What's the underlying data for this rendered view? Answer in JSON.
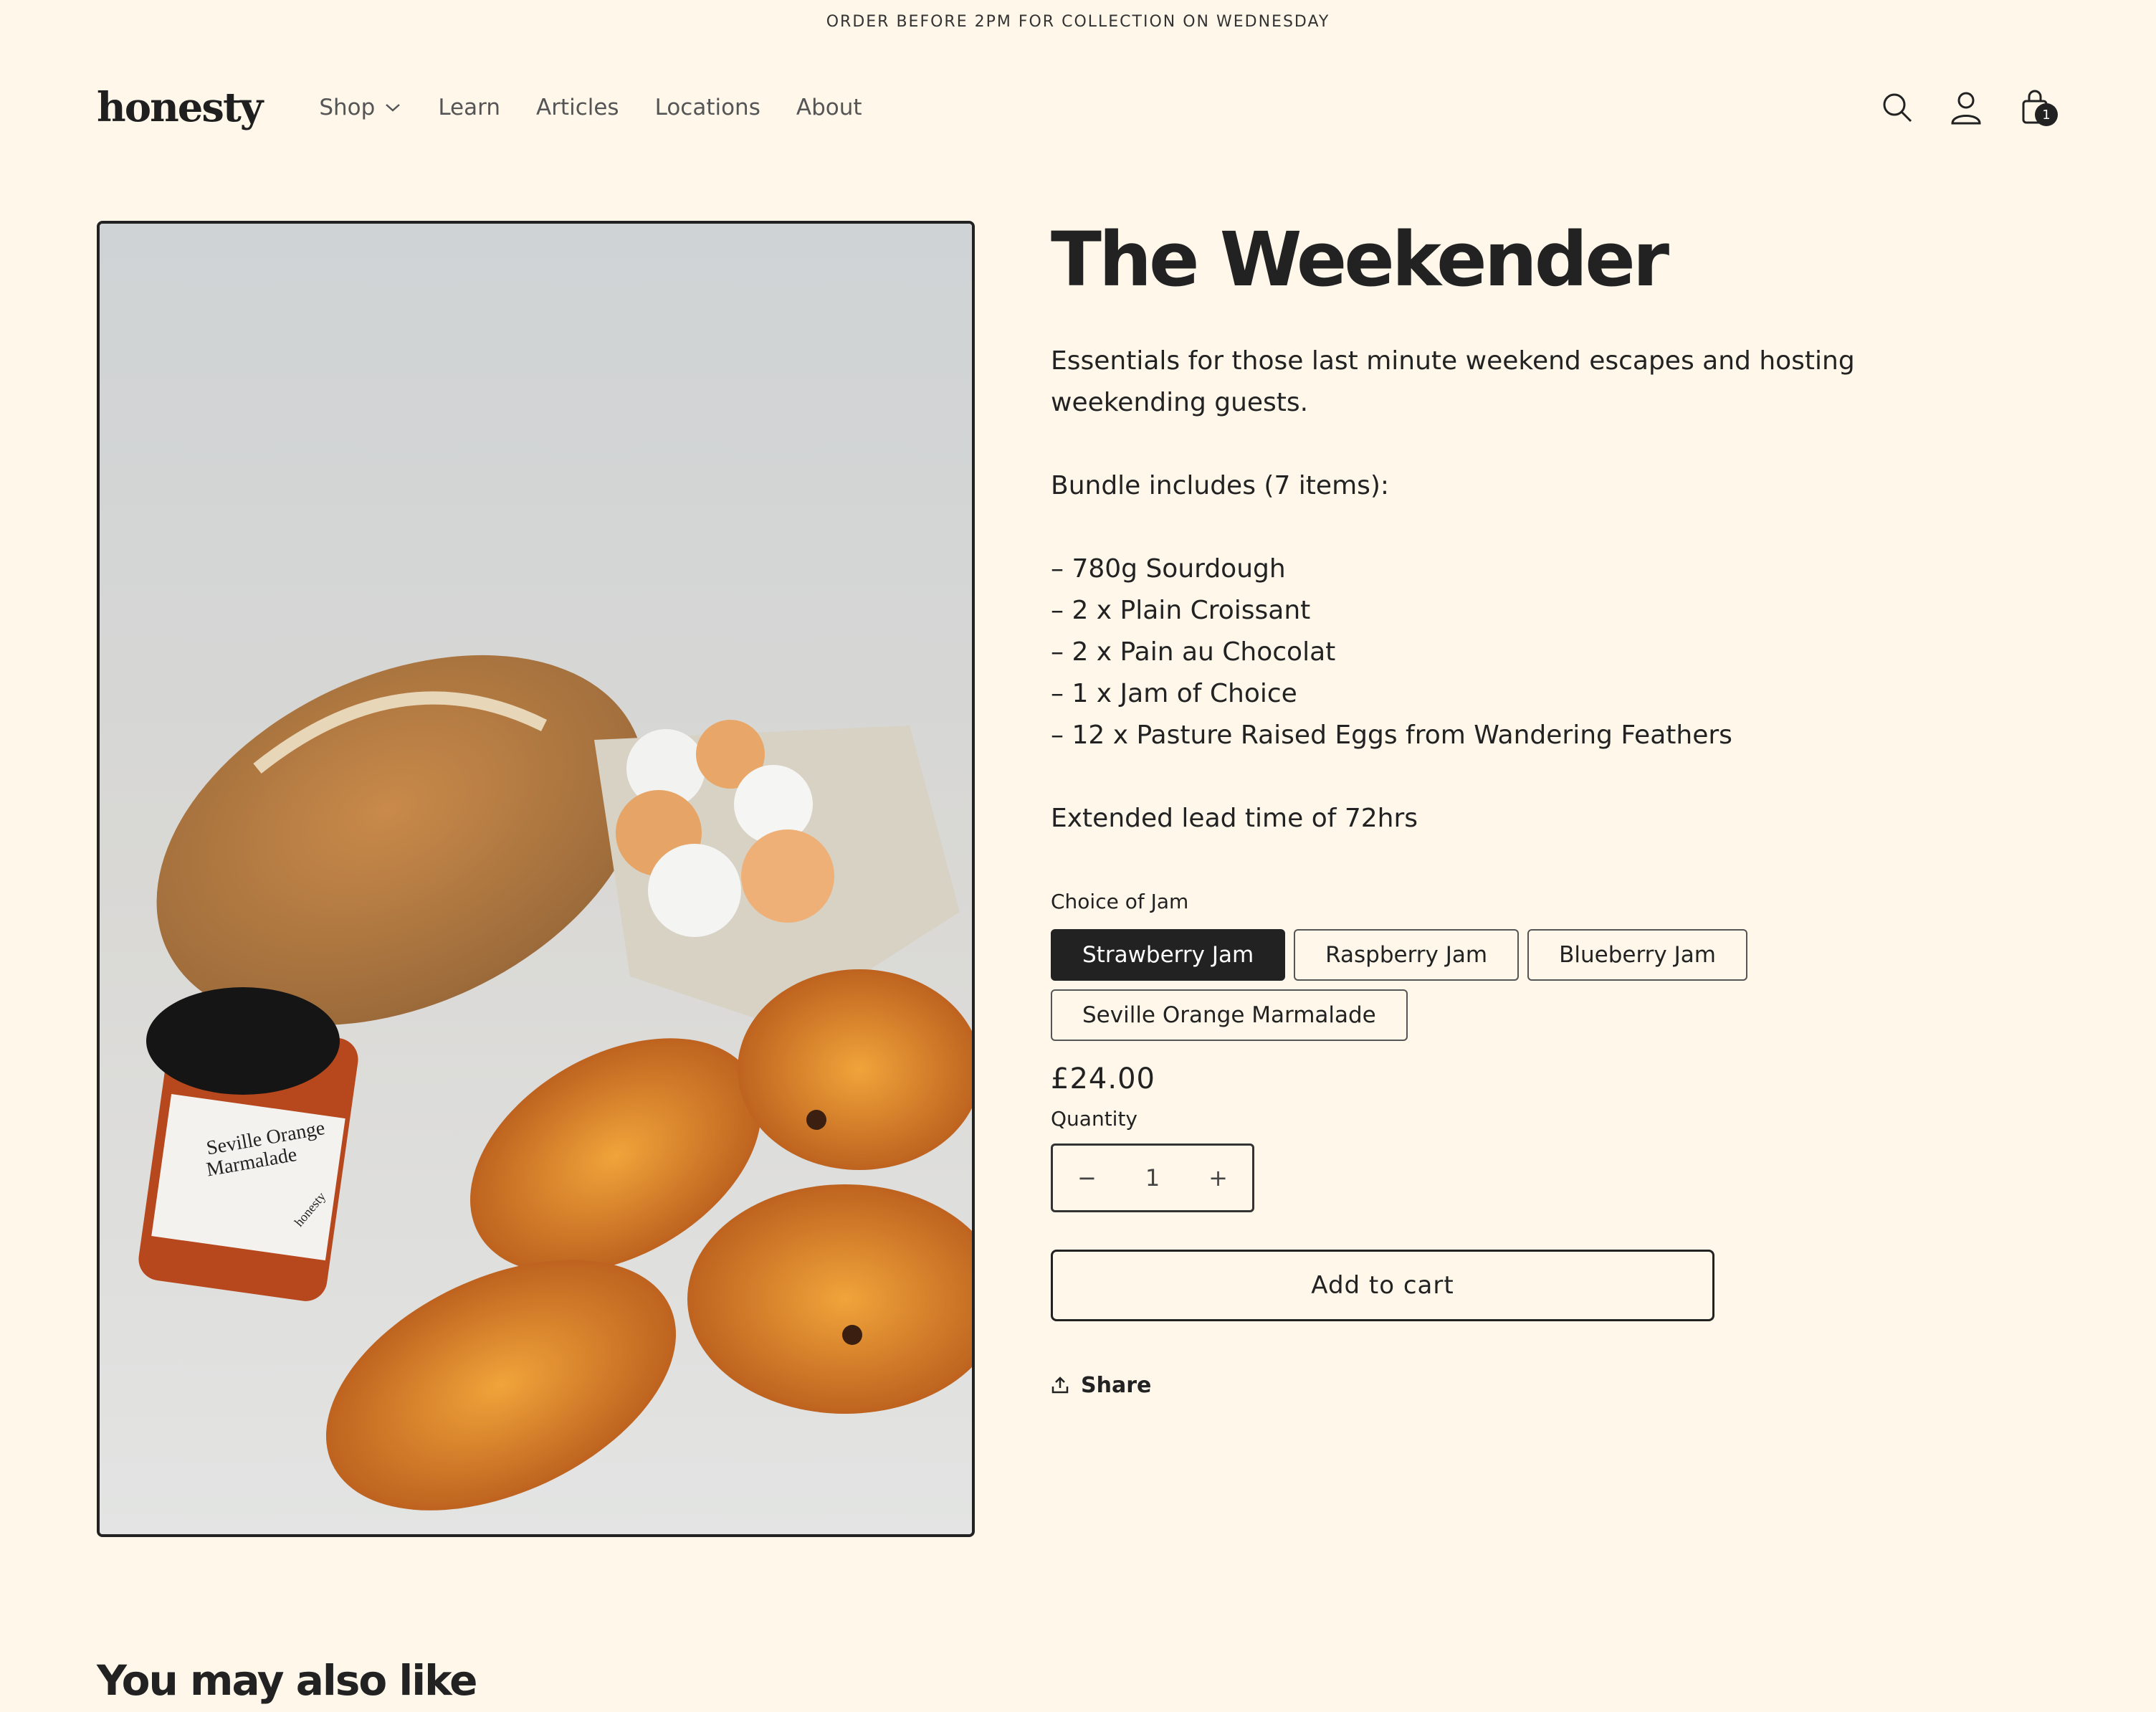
{
  "announcement": "ORDER BEFORE 2PM FOR COLLECTION ON WEDNESDAY",
  "logo": "honesty",
  "nav": [
    {
      "label": "Shop"
    },
    {
      "label": "Learn"
    },
    {
      "label": "Articles"
    },
    {
      "label": "Locations"
    },
    {
      "label": "About"
    }
  ],
  "header_icons": [
    "search-icon",
    "account-icon",
    "cart-icon"
  ],
  "cart_count": "1",
  "product": {
    "title": "The Weekender",
    "description_lines": [
      "Essentials for those last minute weekend escapes and hosting weekending guests.",
      "",
      "Bundle includes (7 items):",
      "",
      "– 780g Sourdough",
      "– 2 x Plain Croissant",
      "– 2 x Pain au Chocolat",
      "– 1 x Jam of Choice",
      "– 12 x Pasture Raised Eggs from Wandering Feathers",
      "",
      "Extended lead time of 72hrs"
    ],
    "option_label": "Choice of Jam",
    "options": [
      {
        "label": "Strawberry Jam",
        "selected": true
      },
      {
        "label": "Raspberry Jam",
        "selected": false
      },
      {
        "label": "Blueberry Jam",
        "selected": false
      },
      {
        "label": "Seville Orange Marmalade",
        "selected": false
      }
    ],
    "price": "£24.00",
    "quantity_label": "Quantity",
    "quantity_value": "1",
    "minus": "−",
    "plus": "+",
    "add_to_cart": "Add to cart",
    "share": "Share"
  },
  "image_label": {
    "jar_line1": "Seville Orange",
    "jar_line2": "Marmalade",
    "jar_brand": "honesty"
  },
  "related_heading": "You may also like"
}
